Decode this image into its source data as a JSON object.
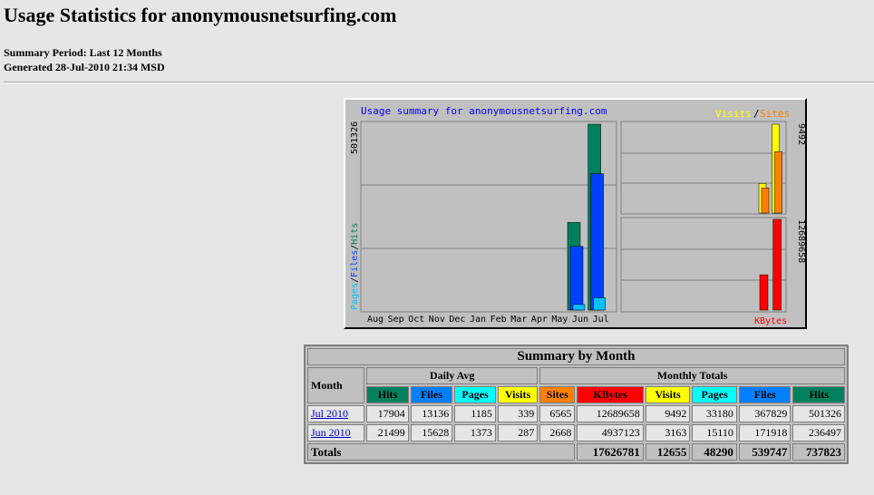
{
  "page": {
    "title": "Usage Statistics for anonymousnetsurfing.com",
    "summary_period": "Summary Period: Last 12 Months",
    "generated": "Generated 28-Jul-2010 21:34 MSD"
  },
  "graph": {
    "title": "Usage summary for anonymousnetsurfing.com",
    "legend_visits": "Visits",
    "legend_sep": "/",
    "legend_sites": "Sites",
    "y_left_max": "501326",
    "y_left_label_pages": "Pages",
    "y_left_label_files": "Files",
    "y_left_label_hits": "Hits",
    "y_right_top_max": "9492",
    "y_right_bottom_max": "12689658",
    "kbytes_label": "KBytes",
    "months": [
      "Aug",
      "Sep",
      "Oct",
      "Nov",
      "Dec",
      "Jan",
      "Feb",
      "Mar",
      "Apr",
      "May",
      "Jun",
      "Jul"
    ],
    "colors": {
      "hits": "#00805c",
      "files": "#0040ff",
      "pages": "#00c0ff",
      "visits": "#ffff00",
      "sites": "#ff8000",
      "kbytes": "#ff0000",
      "title": "#0000ff"
    }
  },
  "chart_data": {
    "type": "bar",
    "title": "Usage summary for anonymousnetsurfing.com",
    "categories": [
      "Aug",
      "Sep",
      "Oct",
      "Nov",
      "Dec",
      "Jan",
      "Feb",
      "Mar",
      "Apr",
      "May",
      "Jun",
      "Jul"
    ],
    "series": [
      {
        "name": "Hits",
        "values": [
          0,
          0,
          0,
          0,
          0,
          0,
          0,
          0,
          0,
          0,
          236497,
          501326
        ]
      },
      {
        "name": "Files",
        "values": [
          0,
          0,
          0,
          0,
          0,
          0,
          0,
          0,
          0,
          0,
          171918,
          367829
        ]
      },
      {
        "name": "Pages",
        "values": [
          0,
          0,
          0,
          0,
          0,
          0,
          0,
          0,
          0,
          0,
          15110,
          33180
        ]
      },
      {
        "name": "Visits",
        "values": [
          0,
          0,
          0,
          0,
          0,
          0,
          0,
          0,
          0,
          0,
          3163,
          9492
        ]
      },
      {
        "name": "Sites",
        "values": [
          0,
          0,
          0,
          0,
          0,
          0,
          0,
          0,
          0,
          0,
          2668,
          6565
        ]
      },
      {
        "name": "KBytes",
        "values": [
          0,
          0,
          0,
          0,
          0,
          0,
          0,
          0,
          0,
          0,
          4937123,
          12689658
        ]
      }
    ],
    "ylim_hits": [
      0,
      501326
    ],
    "ylim_visits": [
      0,
      9492
    ],
    "ylim_kbytes": [
      0,
      12689658
    ]
  },
  "table": {
    "title": "Summary by Month",
    "month_header": "Month",
    "daily_avg_header": "Daily Avg",
    "monthly_totals_header": "Monthly Totals",
    "daily_cols": [
      "Hits",
      "Files",
      "Pages",
      "Visits"
    ],
    "monthly_cols": [
      "Sites",
      "KBytes",
      "Visits",
      "Pages",
      "Files",
      "Hits"
    ],
    "rows": [
      {
        "month": "Jul 2010",
        "d_hits": "17904",
        "d_files": "13136",
        "d_pages": "1185",
        "d_visits": "339",
        "sites": "6565",
        "kbytes": "12689658",
        "visits": "9492",
        "pages": "33180",
        "files": "367829",
        "hits": "501326"
      },
      {
        "month": "Jun 2010",
        "d_hits": "21499",
        "d_files": "15628",
        "d_pages": "1373",
        "d_visits": "287",
        "sites": "2668",
        "kbytes": "4937123",
        "visits": "3163",
        "pages": "15110",
        "files": "171918",
        "hits": "236497"
      }
    ],
    "totals_label": "Totals",
    "totals": {
      "kbytes": "17626781",
      "visits": "12655",
      "pages": "48290",
      "files": "539747",
      "hits": "737823"
    },
    "header_colors": {
      "hits": "#00805c",
      "files": "#0080ff",
      "pages": "#00ffff",
      "visits": "#ffff00",
      "sites": "#ff8000",
      "kbytes": "#ff0000"
    }
  }
}
